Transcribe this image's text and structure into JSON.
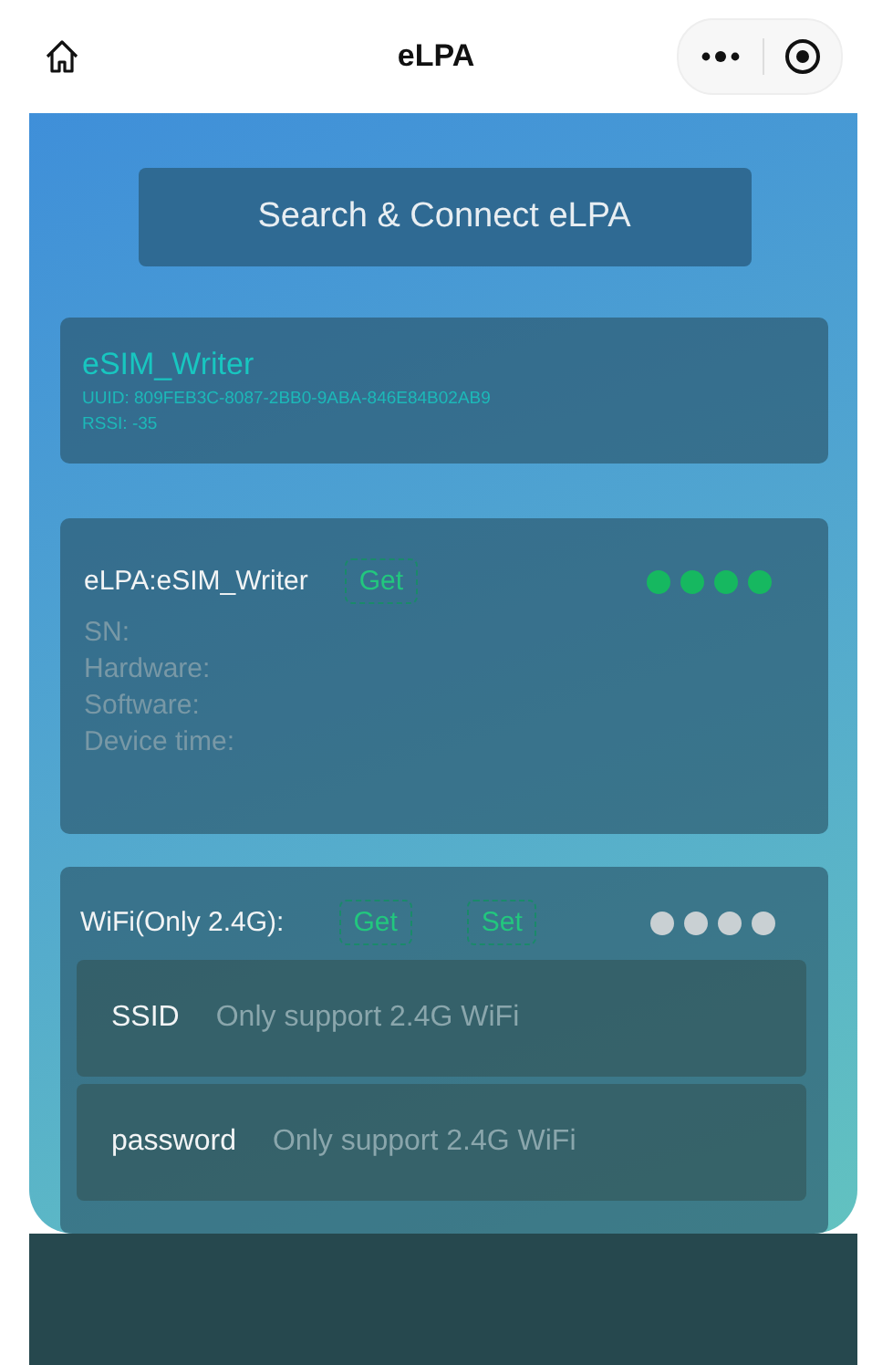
{
  "nav": {
    "title": "eLPA"
  },
  "search_button": "Search & Connect eLPA",
  "device": {
    "name": "eSIM_Writer",
    "uuid": "UUID: 809FEB3C-8087-2BB0-9ABA-846E84B02AB9",
    "rssi": "RSSI: -35"
  },
  "info_card": {
    "title": "eLPA:eSIM_Writer",
    "buttons": [
      "Get"
    ],
    "indicator_on": true,
    "lines": [
      "SN:",
      "Hardware:",
      "Software:",
      "Device time:"
    ]
  },
  "wifi_card": {
    "title": "WiFi(Only 2.4G):",
    "buttons": [
      "Get",
      "Set"
    ],
    "indicator_on": false,
    "fields": [
      {
        "label": "SSID",
        "placeholder": "Only support 2.4G WiFi"
      },
      {
        "label": "password",
        "placeholder": "Only support 2.4G WiFi"
      }
    ]
  }
}
